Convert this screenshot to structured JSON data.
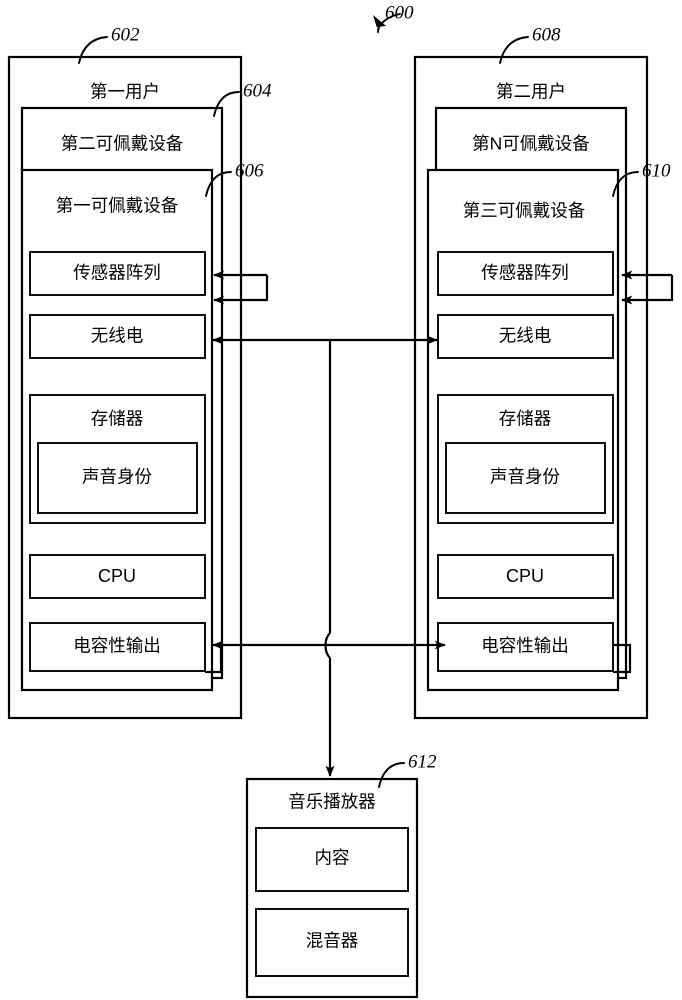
{
  "figure": {
    "number": "600",
    "type": "patent-block-diagram"
  },
  "reference_numerals": {
    "figure": "600",
    "first_user": "602",
    "second_wearable_device": "604",
    "first_wearable_device": "606",
    "second_user": "608",
    "third_wearable_device": "610",
    "music_player": "612"
  },
  "groups": {
    "first_user": {
      "label": "第一用户",
      "ref": "602",
      "second_wearable": {
        "label": "第二可佩戴设备",
        "ref": "604"
      },
      "first_wearable": {
        "label": "第一可佩戴设备",
        "ref": "606",
        "modules": [
          {
            "key": "sensor_array",
            "label": "传感器阵列"
          },
          {
            "key": "radio",
            "label": "无线电"
          },
          {
            "key": "memory",
            "label": "存储器",
            "child": {
              "key": "voice_identity",
              "label": "声音身份"
            }
          },
          {
            "key": "cpu",
            "label": "CPU"
          },
          {
            "key": "capacitive_output",
            "label": "电容性输出"
          }
        ]
      }
    },
    "second_user": {
      "label": "第二用户",
      "ref": "608",
      "nth_wearable": {
        "label": "第N可佩戴设备",
        "ref": null
      },
      "third_wearable": {
        "label": "第三可佩戴设备",
        "ref": "610",
        "modules": [
          {
            "key": "sensor_array",
            "label": "传感器阵列"
          },
          {
            "key": "radio",
            "label": "无线电"
          },
          {
            "key": "memory",
            "label": "存储器",
            "child": {
              "key": "voice_identity",
              "label": "声音身份"
            }
          },
          {
            "key": "cpu",
            "label": "CPU"
          },
          {
            "key": "capacitive_output",
            "label": "电容性输出"
          }
        ]
      }
    },
    "music_player": {
      "label": "音乐播放器",
      "ref": "612",
      "modules": [
        {
          "key": "content",
          "label": "内容"
        },
        {
          "key": "mixer",
          "label": "混音器"
        }
      ]
    }
  },
  "colors": {
    "stroke": "#000000",
    "fill": "#ffffff"
  }
}
